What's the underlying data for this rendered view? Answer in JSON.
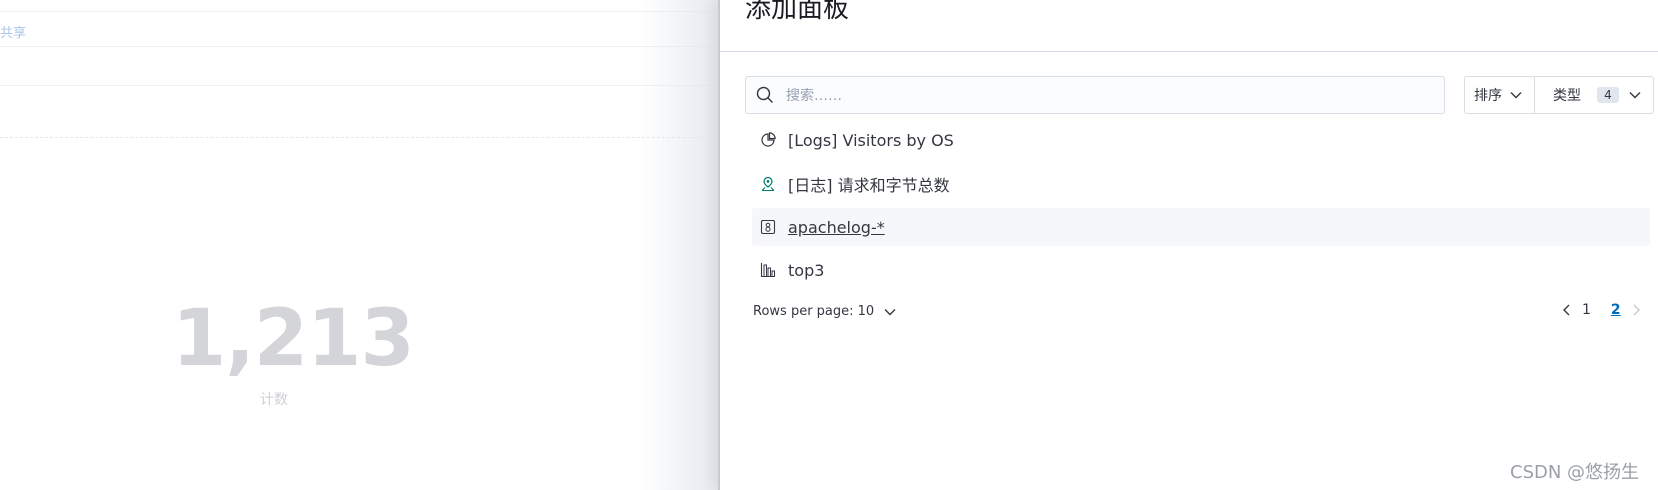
{
  "background": {
    "share_label": "共享",
    "metric_value": "1,213",
    "metric_label": "计数"
  },
  "flyout": {
    "title": "添加面板",
    "search": {
      "placeholder": "搜索……",
      "value": ""
    },
    "sort_label": "排序",
    "type_label": "类型",
    "type_count": "4",
    "items": [
      {
        "label": "[Logs] Visitors by OS",
        "icon": "pie-chart-icon"
      },
      {
        "label": "[日志] 请求和字节总数",
        "icon": "map-pin-icon"
      },
      {
        "label": "apachelog-*",
        "icon": "saved-search-icon"
      },
      {
        "label": "top3",
        "icon": "bar-chart-icon"
      }
    ],
    "rows_per_page": "Rows per page: 10",
    "pagination": {
      "pages": [
        "1",
        "2"
      ],
      "current": "2"
    }
  },
  "watermark": "CSDN @悠扬生",
  "colors": {
    "accent": "#006bb8",
    "border": "#d3dae6",
    "text": "#343741"
  }
}
